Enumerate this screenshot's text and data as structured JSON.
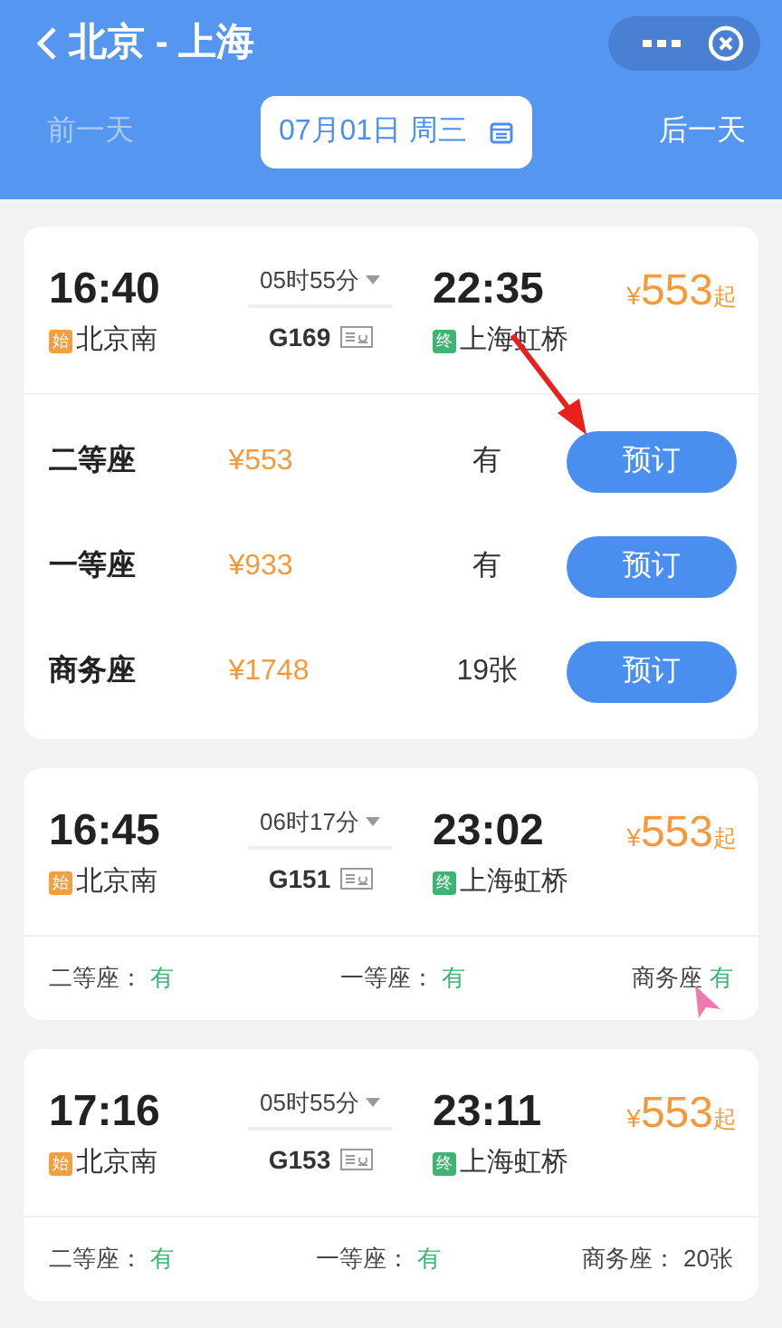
{
  "header": {
    "title": "北京 - 上海",
    "prev_day": {
      "label": "前一天",
      "disabled": true
    },
    "date": "07月01日 周三",
    "next_day": {
      "label": "后一天",
      "disabled": false
    }
  },
  "trains": [
    {
      "expanded": true,
      "depart_time": "16:40",
      "depart_badge": "始",
      "depart_station": "北京南",
      "duration": "05时55分",
      "number": "G169",
      "arrive_time": "22:35",
      "arrive_badge": "终",
      "arrive_station": "上海虹桥",
      "currency": "¥",
      "price": "553",
      "price_suffix": "起",
      "seats": [
        {
          "label": "二等座",
          "price": "¥553",
          "availability": "有",
          "button": "预订"
        },
        {
          "label": "一等座",
          "price": "¥933",
          "availability": "有",
          "button": "预订"
        },
        {
          "label": "商务座",
          "price": "¥1748",
          "availability": "19张",
          "button": "预订"
        }
      ]
    },
    {
      "expanded": false,
      "depart_time": "16:45",
      "depart_badge": "始",
      "depart_station": "北京南",
      "duration": "06时17分",
      "number": "G151",
      "arrive_time": "23:02",
      "arrive_badge": "终",
      "arrive_station": "上海虹桥",
      "currency": "¥",
      "price": "553",
      "price_suffix": "起",
      "seats": [
        {
          "label": "二等座：",
          "availability": "有",
          "available": true
        },
        {
          "label": "一等座：",
          "availability": "有",
          "available": true
        },
        {
          "label": "商务座",
          "availability": "有",
          "available": true
        }
      ]
    },
    {
      "expanded": false,
      "depart_time": "17:16",
      "depart_badge": "始",
      "depart_station": "北京南",
      "duration": "05时55分",
      "number": "G153",
      "arrive_time": "23:11",
      "arrive_badge": "终",
      "arrive_station": "上海虹桥",
      "currency": "¥",
      "price": "553",
      "price_suffix": "起",
      "seats": [
        {
          "label": "二等座：",
          "availability": "有",
          "available": true
        },
        {
          "label": "一等座：",
          "availability": "有",
          "available": true
        },
        {
          "label": "商务座：",
          "availability": "20张",
          "available": false
        }
      ]
    }
  ],
  "annotations": {
    "arrow": true,
    "cursor": true
  }
}
